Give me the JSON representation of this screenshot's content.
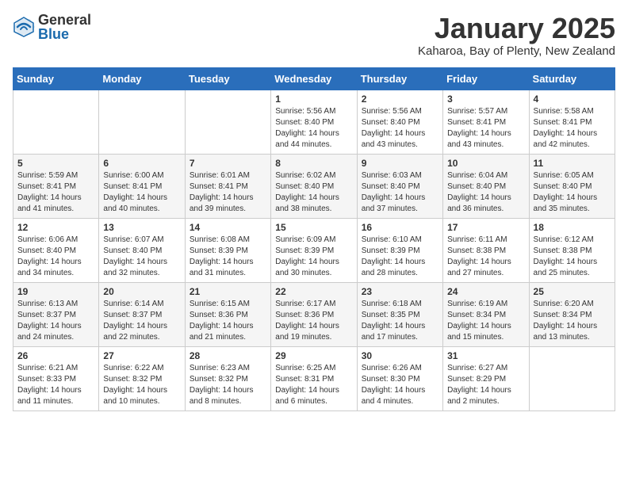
{
  "header": {
    "logo_general": "General",
    "logo_blue": "Blue",
    "month_title": "January 2025",
    "location": "Kaharoa, Bay of Plenty, New Zealand"
  },
  "weekdays": [
    "Sunday",
    "Monday",
    "Tuesday",
    "Wednesday",
    "Thursday",
    "Friday",
    "Saturday"
  ],
  "weeks": [
    [
      {
        "day": "",
        "info": ""
      },
      {
        "day": "",
        "info": ""
      },
      {
        "day": "",
        "info": ""
      },
      {
        "day": "1",
        "info": "Sunrise: 5:56 AM\nSunset: 8:40 PM\nDaylight: 14 hours\nand 44 minutes."
      },
      {
        "day": "2",
        "info": "Sunrise: 5:56 AM\nSunset: 8:40 PM\nDaylight: 14 hours\nand 43 minutes."
      },
      {
        "day": "3",
        "info": "Sunrise: 5:57 AM\nSunset: 8:41 PM\nDaylight: 14 hours\nand 43 minutes."
      },
      {
        "day": "4",
        "info": "Sunrise: 5:58 AM\nSunset: 8:41 PM\nDaylight: 14 hours\nand 42 minutes."
      }
    ],
    [
      {
        "day": "5",
        "info": "Sunrise: 5:59 AM\nSunset: 8:41 PM\nDaylight: 14 hours\nand 41 minutes."
      },
      {
        "day": "6",
        "info": "Sunrise: 6:00 AM\nSunset: 8:41 PM\nDaylight: 14 hours\nand 40 minutes."
      },
      {
        "day": "7",
        "info": "Sunrise: 6:01 AM\nSunset: 8:41 PM\nDaylight: 14 hours\nand 39 minutes."
      },
      {
        "day": "8",
        "info": "Sunrise: 6:02 AM\nSunset: 8:40 PM\nDaylight: 14 hours\nand 38 minutes."
      },
      {
        "day": "9",
        "info": "Sunrise: 6:03 AM\nSunset: 8:40 PM\nDaylight: 14 hours\nand 37 minutes."
      },
      {
        "day": "10",
        "info": "Sunrise: 6:04 AM\nSunset: 8:40 PM\nDaylight: 14 hours\nand 36 minutes."
      },
      {
        "day": "11",
        "info": "Sunrise: 6:05 AM\nSunset: 8:40 PM\nDaylight: 14 hours\nand 35 minutes."
      }
    ],
    [
      {
        "day": "12",
        "info": "Sunrise: 6:06 AM\nSunset: 8:40 PM\nDaylight: 14 hours\nand 34 minutes."
      },
      {
        "day": "13",
        "info": "Sunrise: 6:07 AM\nSunset: 8:40 PM\nDaylight: 14 hours\nand 32 minutes."
      },
      {
        "day": "14",
        "info": "Sunrise: 6:08 AM\nSunset: 8:39 PM\nDaylight: 14 hours\nand 31 minutes."
      },
      {
        "day": "15",
        "info": "Sunrise: 6:09 AM\nSunset: 8:39 PM\nDaylight: 14 hours\nand 30 minutes."
      },
      {
        "day": "16",
        "info": "Sunrise: 6:10 AM\nSunset: 8:39 PM\nDaylight: 14 hours\nand 28 minutes."
      },
      {
        "day": "17",
        "info": "Sunrise: 6:11 AM\nSunset: 8:38 PM\nDaylight: 14 hours\nand 27 minutes."
      },
      {
        "day": "18",
        "info": "Sunrise: 6:12 AM\nSunset: 8:38 PM\nDaylight: 14 hours\nand 25 minutes."
      }
    ],
    [
      {
        "day": "19",
        "info": "Sunrise: 6:13 AM\nSunset: 8:37 PM\nDaylight: 14 hours\nand 24 minutes."
      },
      {
        "day": "20",
        "info": "Sunrise: 6:14 AM\nSunset: 8:37 PM\nDaylight: 14 hours\nand 22 minutes."
      },
      {
        "day": "21",
        "info": "Sunrise: 6:15 AM\nSunset: 8:36 PM\nDaylight: 14 hours\nand 21 minutes."
      },
      {
        "day": "22",
        "info": "Sunrise: 6:17 AM\nSunset: 8:36 PM\nDaylight: 14 hours\nand 19 minutes."
      },
      {
        "day": "23",
        "info": "Sunrise: 6:18 AM\nSunset: 8:35 PM\nDaylight: 14 hours\nand 17 minutes."
      },
      {
        "day": "24",
        "info": "Sunrise: 6:19 AM\nSunset: 8:34 PM\nDaylight: 14 hours\nand 15 minutes."
      },
      {
        "day": "25",
        "info": "Sunrise: 6:20 AM\nSunset: 8:34 PM\nDaylight: 14 hours\nand 13 minutes."
      }
    ],
    [
      {
        "day": "26",
        "info": "Sunrise: 6:21 AM\nSunset: 8:33 PM\nDaylight: 14 hours\nand 11 minutes."
      },
      {
        "day": "27",
        "info": "Sunrise: 6:22 AM\nSunset: 8:32 PM\nDaylight: 14 hours\nand 10 minutes."
      },
      {
        "day": "28",
        "info": "Sunrise: 6:23 AM\nSunset: 8:32 PM\nDaylight: 14 hours\nand 8 minutes."
      },
      {
        "day": "29",
        "info": "Sunrise: 6:25 AM\nSunset: 8:31 PM\nDaylight: 14 hours\nand 6 minutes."
      },
      {
        "day": "30",
        "info": "Sunrise: 6:26 AM\nSunset: 8:30 PM\nDaylight: 14 hours\nand 4 minutes."
      },
      {
        "day": "31",
        "info": "Sunrise: 6:27 AM\nSunset: 8:29 PM\nDaylight: 14 hours\nand 2 minutes."
      },
      {
        "day": "",
        "info": ""
      }
    ]
  ]
}
